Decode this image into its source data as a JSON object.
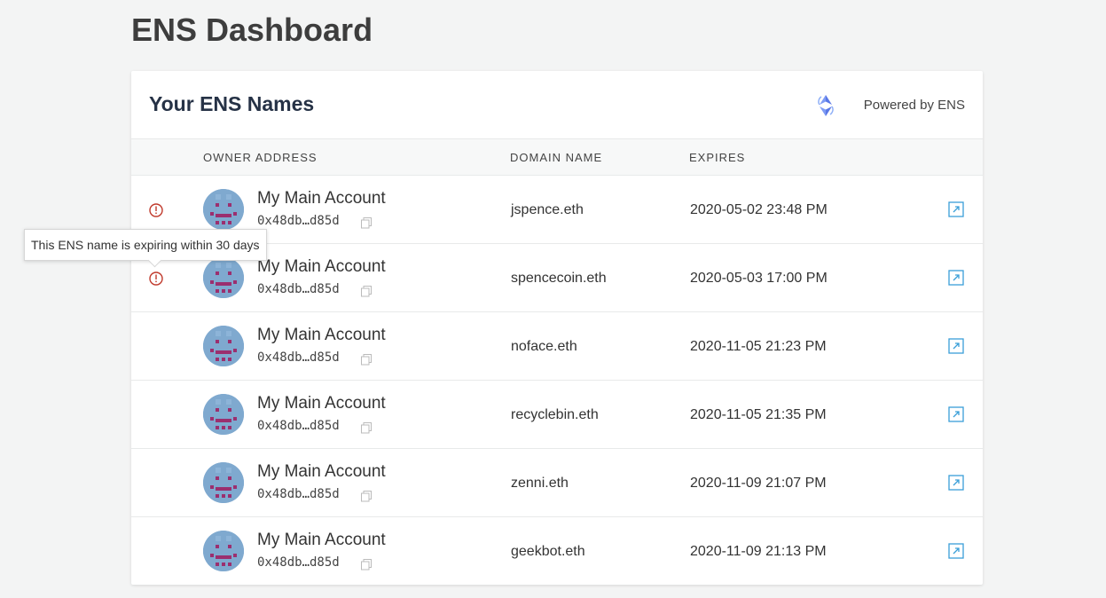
{
  "page": {
    "title": "ENS Dashboard"
  },
  "card": {
    "title": "Your ENS Names",
    "powered_by": "Powered by ENS",
    "logo_icon": "ens-logo-icon"
  },
  "table": {
    "headers": [
      "OWNER ADDRESS",
      "DOMAIN NAME",
      "EXPIRES"
    ],
    "rows": [
      {
        "warning": true,
        "account_name": "My Main Account",
        "address": "0x48db…d85d",
        "domain": "jspence.eth",
        "expires": "2020-05-02 23:48 PM"
      },
      {
        "warning": true,
        "account_name": "My Main Account",
        "address": "0x48db…d85d",
        "domain": "spencecoin.eth",
        "expires": "2020-05-03 17:00 PM"
      },
      {
        "warning": false,
        "account_name": "My Main Account",
        "address": "0x48db…d85d",
        "domain": "noface.eth",
        "expires": "2020-11-05 21:23 PM"
      },
      {
        "warning": false,
        "account_name": "My Main Account",
        "address": "0x48db…d85d",
        "domain": "recyclebin.eth",
        "expires": "2020-11-05 21:35 PM"
      },
      {
        "warning": false,
        "account_name": "My Main Account",
        "address": "0x48db…d85d",
        "domain": "zenni.eth",
        "expires": "2020-11-09 21:07 PM"
      },
      {
        "warning": false,
        "account_name": "My Main Account",
        "address": "0x48db…d85d",
        "domain": "geekbot.eth",
        "expires": "2020-11-09 21:13 PM"
      }
    ]
  },
  "tooltip": {
    "text": "This ENS name is expiring within 30 days"
  },
  "colors": {
    "warning": "#c0392b",
    "link": "#3a9fd8",
    "avatar_bg": "#7fa9cf",
    "avatar_face": "#9b2f6f"
  },
  "icons": {
    "warning": "exclamation-circle-icon",
    "copy": "copy-icon",
    "external_link": "external-link-icon",
    "avatar": "identicon-avatar"
  }
}
